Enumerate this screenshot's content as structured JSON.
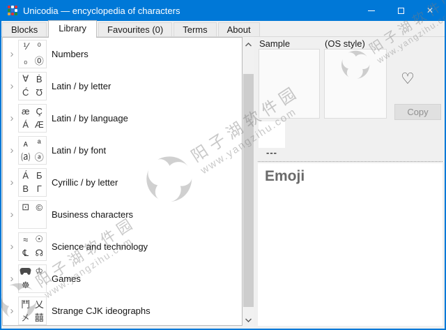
{
  "window": {
    "title": "Unicodia — encyclopedia of characters",
    "controls": {
      "minimize": "minimize",
      "maximize": "maximize",
      "close": "✕"
    }
  },
  "colors": {
    "titlebar": "#0078d7",
    "window_border": "#0078d7",
    "panel_bg": "#f0f0f0",
    "tree_bg": "#ffffff",
    "copy_disabled_text": "#8f8f8f",
    "heading_gray": "#6a6a6a"
  },
  "tabs": [
    {
      "label": "Blocks",
      "active": false
    },
    {
      "label": "Library",
      "active": true
    },
    {
      "label": "Favourites (0)",
      "active": false
    },
    {
      "label": "Terms",
      "active": false
    },
    {
      "label": "About",
      "active": false
    }
  ],
  "icons": {
    "expand_chevron": "›",
    "favourite_heart": "♡",
    "scroll_up": "chevron-up-shape",
    "scroll_down": "chevron-down-shape",
    "gamepad": "gamepad-shape",
    "app_logo": "color-mosaic"
  },
  "tree": {
    "items": [
      {
        "label": "Numbers",
        "glyphs": [
          "⅟",
          "⁰",
          "₀",
          "⓪"
        ]
      },
      {
        "label": "Latin / by letter",
        "glyphs": [
          "∀",
          "Ḃ",
          "Ć",
          "Ʊ"
        ]
      },
      {
        "label": "Latin / by language",
        "glyphs": [
          "æ",
          "Ç",
          "Á",
          "Æ"
        ]
      },
      {
        "label": "Latin / by font",
        "glyphs": [
          "ᴀ",
          "ª",
          "⒜",
          "ⓐ"
        ]
      },
      {
        "label": "Cyrillic / by letter",
        "glyphs": [
          "А́",
          "Б",
          "В",
          "Г"
        ]
      },
      {
        "label": "Business characters",
        "glyphs": [
          "⊡",
          "©",
          "",
          ""
        ]
      },
      {
        "label": "Science and technology",
        "glyphs": [
          "≈",
          "☉",
          "℄",
          "☊"
        ]
      },
      {
        "label": "Games",
        "glyphs": [
          "",
          "♔",
          "☸",
          ""
        ]
      },
      {
        "label": "Strange CJK ideographs",
        "glyphs": [
          "鬥",
          "乂",
          "㐅",
          "囍"
        ]
      }
    ]
  },
  "detail": {
    "sample_label": "Sample",
    "os_style_label": "(OS style)",
    "copy_label": "Copy",
    "code_placeholder": "---",
    "heading": "Emoji"
  },
  "watermark": {
    "line1": "阳子湖软件园",
    "line2": "www.yangzihu.com"
  }
}
